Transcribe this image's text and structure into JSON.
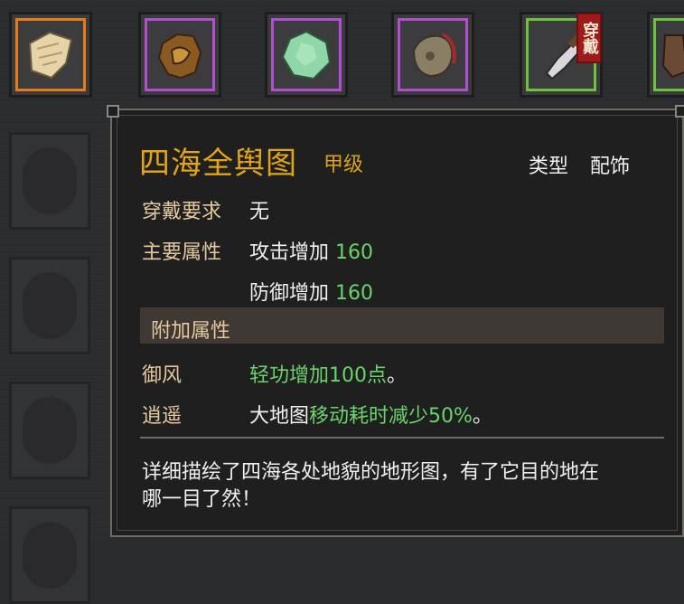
{
  "inventory": {
    "slots": [
      {
        "icon": "map-scroll-icon",
        "rarity": "orange"
      },
      {
        "icon": "leather-armor-icon",
        "rarity": "purple"
      },
      {
        "icon": "jade-stone-icon",
        "rarity": "purple"
      },
      {
        "icon": "pouch-icon",
        "rarity": "purple"
      },
      {
        "icon": "cleaver-icon",
        "rarity": "green",
        "badge": "穿戴"
      },
      {
        "icon": "boots-icon",
        "rarity": "green"
      }
    ]
  },
  "item": {
    "name": "四海全舆图",
    "grade": "甲级",
    "type_label": "类型",
    "type_value": "配饰",
    "requirement_label": "穿戴要求",
    "requirement_value": "无",
    "main_attr_label": "主要属性",
    "main_attrs": [
      {
        "text": "攻击增加",
        "value": "160"
      },
      {
        "text": "防御增加",
        "value": "160"
      }
    ],
    "extra_header": "附加属性",
    "extra_attrs": [
      {
        "name": "御风",
        "prefix": "",
        "effect": "轻功增加100点",
        "suffix": "。"
      },
      {
        "name": "逍遥",
        "prefix": "大地图",
        "effect": "移动耗时减少50%",
        "suffix": "。"
      }
    ],
    "description_line1": "详细描绘了四海各处地貌的地形图，有了它目的地在",
    "description_line2": "哪一目了然！"
  },
  "colors": {
    "title": "#e2a418",
    "label": "#e4c9a0",
    "positive": "#6ad36a",
    "rarity_orange": "#e57c18",
    "rarity_purple": "#b04fd0",
    "rarity_green": "#6cc43a"
  }
}
